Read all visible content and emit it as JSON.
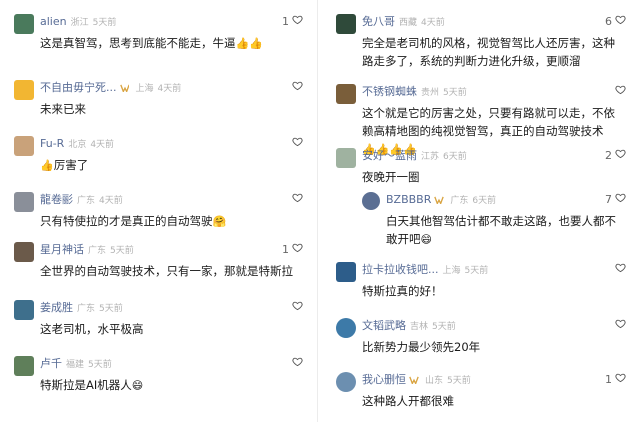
{
  "thumb_emoji": "👍",
  "hug_emoji": "🤗",
  "laugh_emoji": "😄",
  "left_comments": [
    {
      "name": "alien",
      "location": "浙江",
      "time": "5天前",
      "likes": "1",
      "text": "这是真智驾，思考到底能不能走，牛逼",
      "emoji_suffix": "👍👍",
      "avatar_color": "#4a7a5c"
    },
    {
      "name": "不自由毋宁死...",
      "location": "上海",
      "time": "4天前",
      "likes": "",
      "text": "未来已来",
      "emoji_suffix": "",
      "avatar_color": "#f2b632",
      "vip": true
    },
    {
      "name": "Fu-R",
      "location": "北京",
      "time": "4天前",
      "likes": "",
      "text": "厉害了",
      "emoji_prefix": "👍",
      "avatar_color": "#c9a27a"
    },
    {
      "name": "龍卷彨",
      "location": "广东",
      "time": "4天前",
      "likes": "",
      "text": "只有特使拉的才是真正的自动驾驶",
      "emoji_suffix": "🤗",
      "avatar_color": "#8a8f99"
    },
    {
      "name": "星月神话",
      "location": "广东",
      "time": "5天前",
      "likes": "1",
      "text": "全世界的自动驾驶技术，只有一家，那就是特斯拉",
      "emoji_suffix": "",
      "avatar_color": "#6b5a4a"
    },
    {
      "name": "姜成胜",
      "location": "广东",
      "time": "5天前",
      "likes": "",
      "text": "这老司机，水平极高",
      "emoji_suffix": "",
      "avatar_color": "#3e6f8c"
    },
    {
      "name": "卢千",
      "location": "福建",
      "time": "5天前",
      "likes": "",
      "text": "特斯拉是AI机器人",
      "emoji_suffix": "😄",
      "avatar_color": "#5f7f5a"
    }
  ],
  "right_comments": [
    {
      "name": "免八哥",
      "location": "西藏",
      "time": "4天前",
      "likes": "6",
      "text": "完全是老司机的风格，视觉智驾比人还厉害，这种路走多了，系统的判断力进化升级，更顺溜",
      "avatar_color": "#2f4a3a"
    },
    {
      "name": "不锈钢蜘蛛",
      "location": "贵州",
      "time": "5天前",
      "likes": "",
      "text": "这个就是它的厉害之处，只要有路就可以走，不依赖高精地图的纯视觉智驾，真正的自动驾驶技术",
      "emoji_suffix": "👍👍👍👍",
      "avatar_color": "#7a5e3a"
    },
    {
      "name": "安好～蓝雨",
      "location": "江苏",
      "time": "6天前",
      "likes": "2",
      "text": "夜晚开一圈",
      "avatar_color": "#9fb2a0"
    },
    {
      "name": "BZBBBR",
      "location": "广东",
      "time": "6天前",
      "likes": "7",
      "text": "白天其他智驾估计都不敢走这路，也要人都不敢开吧",
      "emoji_suffix": "😄",
      "avatar_color": "#5b6f93",
      "vip": true,
      "reply": true
    },
    {
      "name": "拉卡拉收钱吧...",
      "location": "上海",
      "time": "5天前",
      "likes": "",
      "text": "特斯拉真的好！",
      "avatar_color": "#2d5d8a"
    },
    {
      "name": "文韬武略",
      "location": "吉林",
      "time": "5天前",
      "likes": "",
      "text": "比新势力最少领先20年",
      "avatar_color": "#3d7aa8"
    },
    {
      "name": "我心删恒",
      "location": "山东",
      "time": "5天前",
      "likes": "1",
      "text": "这种路人开都很难",
      "avatar_color": "#6c8fb0",
      "vip": true
    }
  ]
}
